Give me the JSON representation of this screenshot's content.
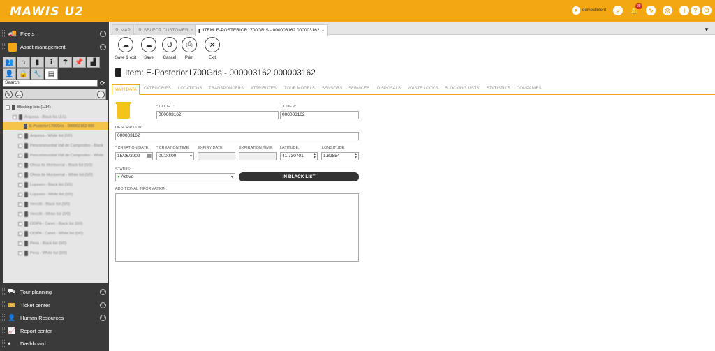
{
  "header": {
    "logo": "MAWIS U2",
    "user": "democliment",
    "notif_count": "29"
  },
  "sidebar": {
    "fleets": "Fleets",
    "asset_management": "Asset management",
    "search_value": "Search",
    "tree_root": "Blocking lists (1/14)",
    "tree_items": [
      "Arquesa - Black list (1/1)",
      "E-Posterior1700Gris - 000003162 000",
      "Arquesa - White list (0/0)",
      "Pencommunitat Vall de Camprodon - Black",
      "Pencommunitat Vall de Camprodon - White",
      "Olesa de Montserrat - Black list (0/0)",
      "Olesa de Montserrat - White list (0/0)",
      "Lupasen - Black list (0/0)",
      "Lupasen - White list (0/0)",
      "Vencilit - Black list (0/0)",
      "Vencilit - White list (0/0)",
      "ODIPA - Canet - Black list (0/0)",
      "ODIPA - Canet - White list (0/0)",
      "Pena - Black list (0/0)",
      "Pena - White list (0/0)"
    ],
    "bottom": [
      "Tour planning",
      "Ticket center",
      "Human Resources",
      "Report center",
      "Dashboard"
    ]
  },
  "tabs": [
    {
      "label": "MAP"
    },
    {
      "label": "SELECT CUSTOMER"
    },
    {
      "label": "ITEM: E-POSTERIOR1700GRIS - 000003162 000003162"
    }
  ],
  "toolbar": [
    "Save & exit",
    "Save",
    "Cancel",
    "Print",
    "Exit"
  ],
  "title": "Item: E-Posterior1700Gris - 000003162 000003162",
  "subtabs": [
    "MAIN DATA",
    "CATEGORIES",
    "LOCATIONS",
    "TRANSPONDERS",
    "ATTRIBUTES",
    "TOUR MODELS",
    "SENSORS",
    "SERVICES",
    "DISPOSALS",
    "WASTE LOCKS",
    "BLOCKING LISTS",
    "STATISTICS",
    "COMPANIES"
  ],
  "form": {
    "code1_label": "* CODE 1:",
    "code1": "000003162",
    "code2_label": "CODE 2:",
    "code2": "000003162",
    "desc_label": "DESCRIPTION:",
    "desc": "000003162",
    "cdate_label": "* CREATION DATE:",
    "cdate": "15/06/2009",
    "ctime_label": "* CREATION TIME:",
    "ctime": "00:00:00",
    "edate_label": "EXPIRY DATE:",
    "etime_label": "EXPIRATION TIME:",
    "lat_label": "LATITUDE:",
    "lat": "41.730701",
    "lon_label": "LONGITUDE:",
    "lon": "1.82854",
    "status_label": "STATUS:",
    "status": "Active",
    "blacklist_btn": "IN BLACK LIST",
    "addinfo_label": "ADDITIONAL INFORMATION:"
  },
  "colors": {
    "accent": "#f3a712",
    "sidebar": "#3a3a3a"
  }
}
